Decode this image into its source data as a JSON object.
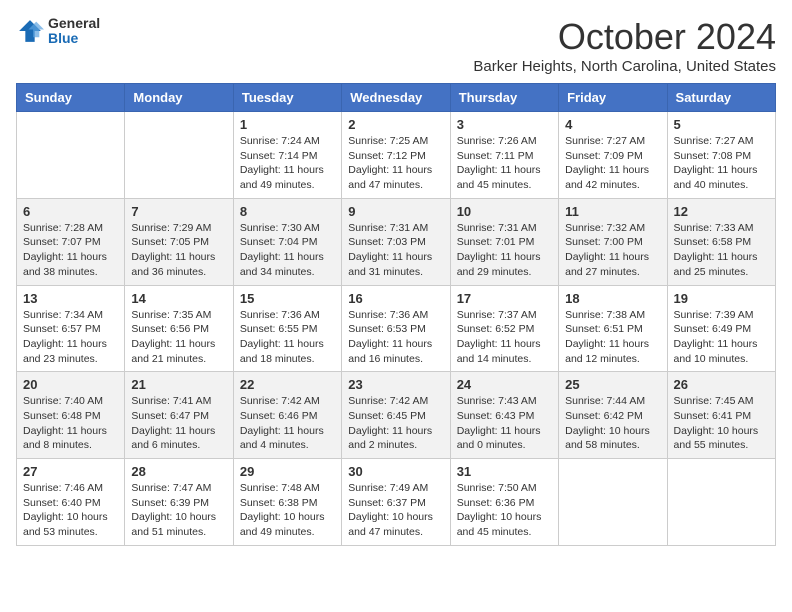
{
  "header": {
    "logo_general": "General",
    "logo_blue": "Blue",
    "month_title": "October 2024",
    "location": "Barker Heights, North Carolina, United States"
  },
  "weekdays": [
    "Sunday",
    "Monday",
    "Tuesday",
    "Wednesday",
    "Thursday",
    "Friday",
    "Saturday"
  ],
  "weeks": [
    [
      {
        "day": "",
        "sunrise": "",
        "sunset": "",
        "daylight": ""
      },
      {
        "day": "",
        "sunrise": "",
        "sunset": "",
        "daylight": ""
      },
      {
        "day": "1",
        "sunrise": "Sunrise: 7:24 AM",
        "sunset": "Sunset: 7:14 PM",
        "daylight": "Daylight: 11 hours and 49 minutes."
      },
      {
        "day": "2",
        "sunrise": "Sunrise: 7:25 AM",
        "sunset": "Sunset: 7:12 PM",
        "daylight": "Daylight: 11 hours and 47 minutes."
      },
      {
        "day": "3",
        "sunrise": "Sunrise: 7:26 AM",
        "sunset": "Sunset: 7:11 PM",
        "daylight": "Daylight: 11 hours and 45 minutes."
      },
      {
        "day": "4",
        "sunrise": "Sunrise: 7:27 AM",
        "sunset": "Sunset: 7:09 PM",
        "daylight": "Daylight: 11 hours and 42 minutes."
      },
      {
        "day": "5",
        "sunrise": "Sunrise: 7:27 AM",
        "sunset": "Sunset: 7:08 PM",
        "daylight": "Daylight: 11 hours and 40 minutes."
      }
    ],
    [
      {
        "day": "6",
        "sunrise": "Sunrise: 7:28 AM",
        "sunset": "Sunset: 7:07 PM",
        "daylight": "Daylight: 11 hours and 38 minutes."
      },
      {
        "day": "7",
        "sunrise": "Sunrise: 7:29 AM",
        "sunset": "Sunset: 7:05 PM",
        "daylight": "Daylight: 11 hours and 36 minutes."
      },
      {
        "day": "8",
        "sunrise": "Sunrise: 7:30 AM",
        "sunset": "Sunset: 7:04 PM",
        "daylight": "Daylight: 11 hours and 34 minutes."
      },
      {
        "day": "9",
        "sunrise": "Sunrise: 7:31 AM",
        "sunset": "Sunset: 7:03 PM",
        "daylight": "Daylight: 11 hours and 31 minutes."
      },
      {
        "day": "10",
        "sunrise": "Sunrise: 7:31 AM",
        "sunset": "Sunset: 7:01 PM",
        "daylight": "Daylight: 11 hours and 29 minutes."
      },
      {
        "day": "11",
        "sunrise": "Sunrise: 7:32 AM",
        "sunset": "Sunset: 7:00 PM",
        "daylight": "Daylight: 11 hours and 27 minutes."
      },
      {
        "day": "12",
        "sunrise": "Sunrise: 7:33 AM",
        "sunset": "Sunset: 6:58 PM",
        "daylight": "Daylight: 11 hours and 25 minutes."
      }
    ],
    [
      {
        "day": "13",
        "sunrise": "Sunrise: 7:34 AM",
        "sunset": "Sunset: 6:57 PM",
        "daylight": "Daylight: 11 hours and 23 minutes."
      },
      {
        "day": "14",
        "sunrise": "Sunrise: 7:35 AM",
        "sunset": "Sunset: 6:56 PM",
        "daylight": "Daylight: 11 hours and 21 minutes."
      },
      {
        "day": "15",
        "sunrise": "Sunrise: 7:36 AM",
        "sunset": "Sunset: 6:55 PM",
        "daylight": "Daylight: 11 hours and 18 minutes."
      },
      {
        "day": "16",
        "sunrise": "Sunrise: 7:36 AM",
        "sunset": "Sunset: 6:53 PM",
        "daylight": "Daylight: 11 hours and 16 minutes."
      },
      {
        "day": "17",
        "sunrise": "Sunrise: 7:37 AM",
        "sunset": "Sunset: 6:52 PM",
        "daylight": "Daylight: 11 hours and 14 minutes."
      },
      {
        "day": "18",
        "sunrise": "Sunrise: 7:38 AM",
        "sunset": "Sunset: 6:51 PM",
        "daylight": "Daylight: 11 hours and 12 minutes."
      },
      {
        "day": "19",
        "sunrise": "Sunrise: 7:39 AM",
        "sunset": "Sunset: 6:49 PM",
        "daylight": "Daylight: 11 hours and 10 minutes."
      }
    ],
    [
      {
        "day": "20",
        "sunrise": "Sunrise: 7:40 AM",
        "sunset": "Sunset: 6:48 PM",
        "daylight": "Daylight: 11 hours and 8 minutes."
      },
      {
        "day": "21",
        "sunrise": "Sunrise: 7:41 AM",
        "sunset": "Sunset: 6:47 PM",
        "daylight": "Daylight: 11 hours and 6 minutes."
      },
      {
        "day": "22",
        "sunrise": "Sunrise: 7:42 AM",
        "sunset": "Sunset: 6:46 PM",
        "daylight": "Daylight: 11 hours and 4 minutes."
      },
      {
        "day": "23",
        "sunrise": "Sunrise: 7:42 AM",
        "sunset": "Sunset: 6:45 PM",
        "daylight": "Daylight: 11 hours and 2 minutes."
      },
      {
        "day": "24",
        "sunrise": "Sunrise: 7:43 AM",
        "sunset": "Sunset: 6:43 PM",
        "daylight": "Daylight: 11 hours and 0 minutes."
      },
      {
        "day": "25",
        "sunrise": "Sunrise: 7:44 AM",
        "sunset": "Sunset: 6:42 PM",
        "daylight": "Daylight: 10 hours and 58 minutes."
      },
      {
        "day": "26",
        "sunrise": "Sunrise: 7:45 AM",
        "sunset": "Sunset: 6:41 PM",
        "daylight": "Daylight: 10 hours and 55 minutes."
      }
    ],
    [
      {
        "day": "27",
        "sunrise": "Sunrise: 7:46 AM",
        "sunset": "Sunset: 6:40 PM",
        "daylight": "Daylight: 10 hours and 53 minutes."
      },
      {
        "day": "28",
        "sunrise": "Sunrise: 7:47 AM",
        "sunset": "Sunset: 6:39 PM",
        "daylight": "Daylight: 10 hours and 51 minutes."
      },
      {
        "day": "29",
        "sunrise": "Sunrise: 7:48 AM",
        "sunset": "Sunset: 6:38 PM",
        "daylight": "Daylight: 10 hours and 49 minutes."
      },
      {
        "day": "30",
        "sunrise": "Sunrise: 7:49 AM",
        "sunset": "Sunset: 6:37 PM",
        "daylight": "Daylight: 10 hours and 47 minutes."
      },
      {
        "day": "31",
        "sunrise": "Sunrise: 7:50 AM",
        "sunset": "Sunset: 6:36 PM",
        "daylight": "Daylight: 10 hours and 45 minutes."
      },
      {
        "day": "",
        "sunrise": "",
        "sunset": "",
        "daylight": ""
      },
      {
        "day": "",
        "sunrise": "",
        "sunset": "",
        "daylight": ""
      }
    ]
  ]
}
